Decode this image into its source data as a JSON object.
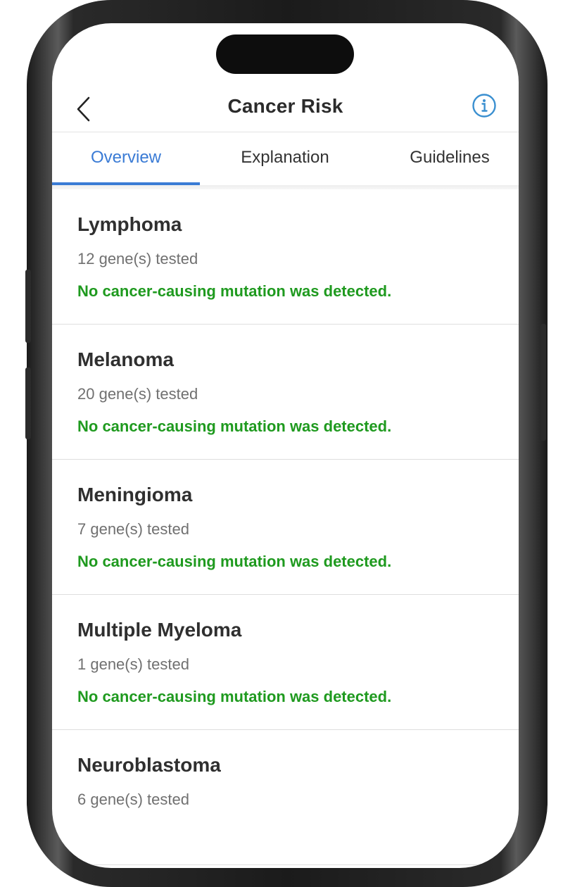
{
  "header": {
    "title": "Cancer Risk",
    "back_icon": "chevron-left-icon",
    "info_icon": "info-circle-icon"
  },
  "tabs": [
    {
      "label": "Overview",
      "active": true
    },
    {
      "label": "Explanation",
      "active": false
    },
    {
      "label": "Guidelines",
      "active": false
    }
  ],
  "colors": {
    "accent": "#3a7bd5",
    "status_ok": "#1f9a1f",
    "title_text": "#2b2b2b",
    "muted_text": "#707070"
  },
  "cancers": [
    {
      "name": "Lymphoma",
      "genes": "12 gene(s) tested",
      "status": "No cancer-causing mutation was detected."
    },
    {
      "name": "Melanoma",
      "genes": "20 gene(s) tested",
      "status": "No cancer-causing mutation was detected."
    },
    {
      "name": "Meningioma",
      "genes": "7 gene(s) tested",
      "status": "No cancer-causing mutation was detected."
    },
    {
      "name": "Multiple Myeloma",
      "genes": "1 gene(s) tested",
      "status": "No cancer-causing mutation was detected."
    },
    {
      "name": "Neuroblastoma",
      "genes": "6 gene(s) tested",
      "status": ""
    }
  ]
}
